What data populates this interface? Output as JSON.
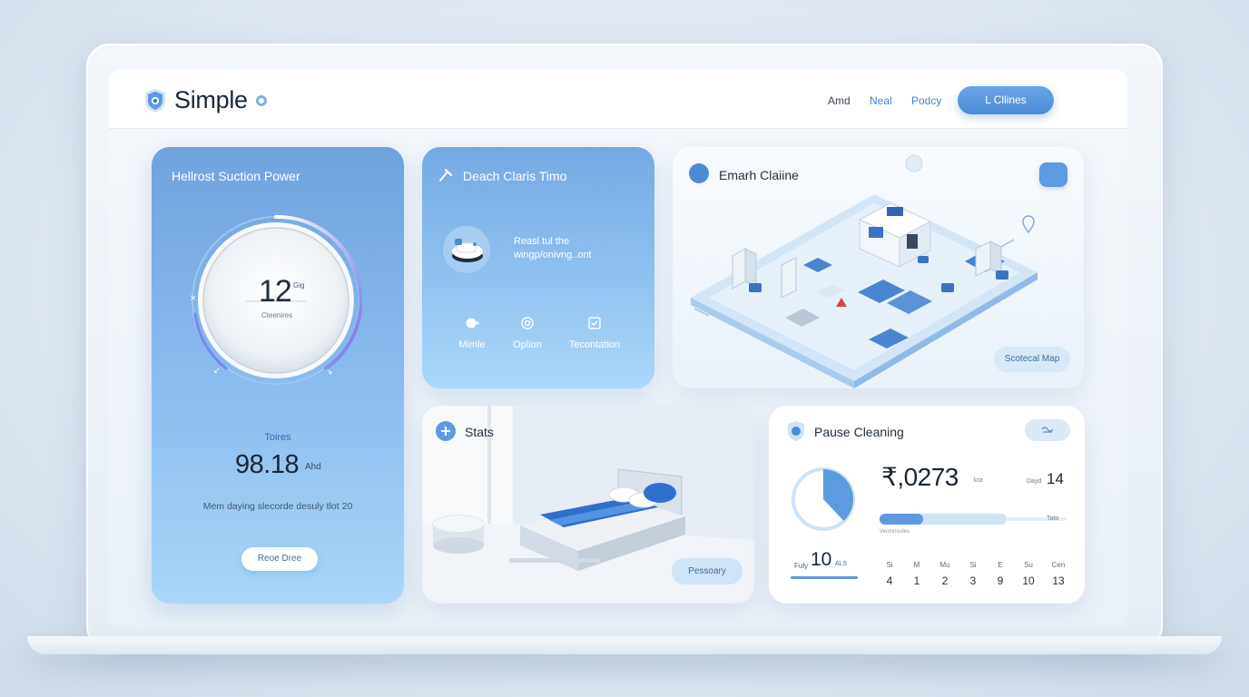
{
  "header": {
    "brand": "Simple",
    "nav": [
      "Amd",
      "Neal",
      "Podcy"
    ],
    "cta_label": "L Cllines"
  },
  "suction": {
    "title": "Hellrost Suction Power",
    "dial_value": "12",
    "dial_unit": "Gig",
    "dial_sublabel": "Cteenires",
    "stat_label": "Toires",
    "stat_value": "98.18",
    "stat_unit": "Ahd",
    "description": "Mem daying slecorde desuly tlot 20",
    "button_label": "Reoe Dree"
  },
  "clean_time": {
    "title": "Deach Claris Timo",
    "text_line1": "Reasl tul the",
    "text_line2": "wingp/onivng..ont",
    "actions": [
      {
        "label": "Mimle",
        "icon": "plus-circle-icon"
      },
      {
        "label": "Oplion",
        "icon": "target-icon"
      },
      {
        "label": "Tecontation",
        "icon": "check-square-icon"
      }
    ]
  },
  "map": {
    "title": "Emarh Claiine",
    "chip_label": "Scotecal Map"
  },
  "stats": {
    "title": "Stats",
    "button_label": "Pessoary"
  },
  "pause": {
    "title": "Pause Cleaning",
    "big_value": "₹,0273",
    "big_unit": "kra",
    "days_label": "Dayd",
    "days_value": "14",
    "progress_fraction": 0.34,
    "progress_sublabel": "Vecmmodes",
    "progress_end_label": "Tato",
    "pie_fraction": 0.38,
    "fly_label": "Fuly",
    "fly_value": "10",
    "fly_unit": "ALS",
    "week": [
      {
        "day": "Si",
        "num": "4"
      },
      {
        "day": "M",
        "num": "1"
      },
      {
        "day": "Mu",
        "num": "2"
      },
      {
        "day": "Si",
        "num": "3"
      },
      {
        "day": "E",
        "num": "9"
      },
      {
        "day": "Su",
        "num": "10"
      },
      {
        "day": "Cen",
        "num": "13"
      }
    ]
  },
  "colors": {
    "accent": "#4a8bd6",
    "card_blue_top": "#6fa3de",
    "card_blue_bottom": "#a9d6f8",
    "text_dark": "#1a2636"
  }
}
